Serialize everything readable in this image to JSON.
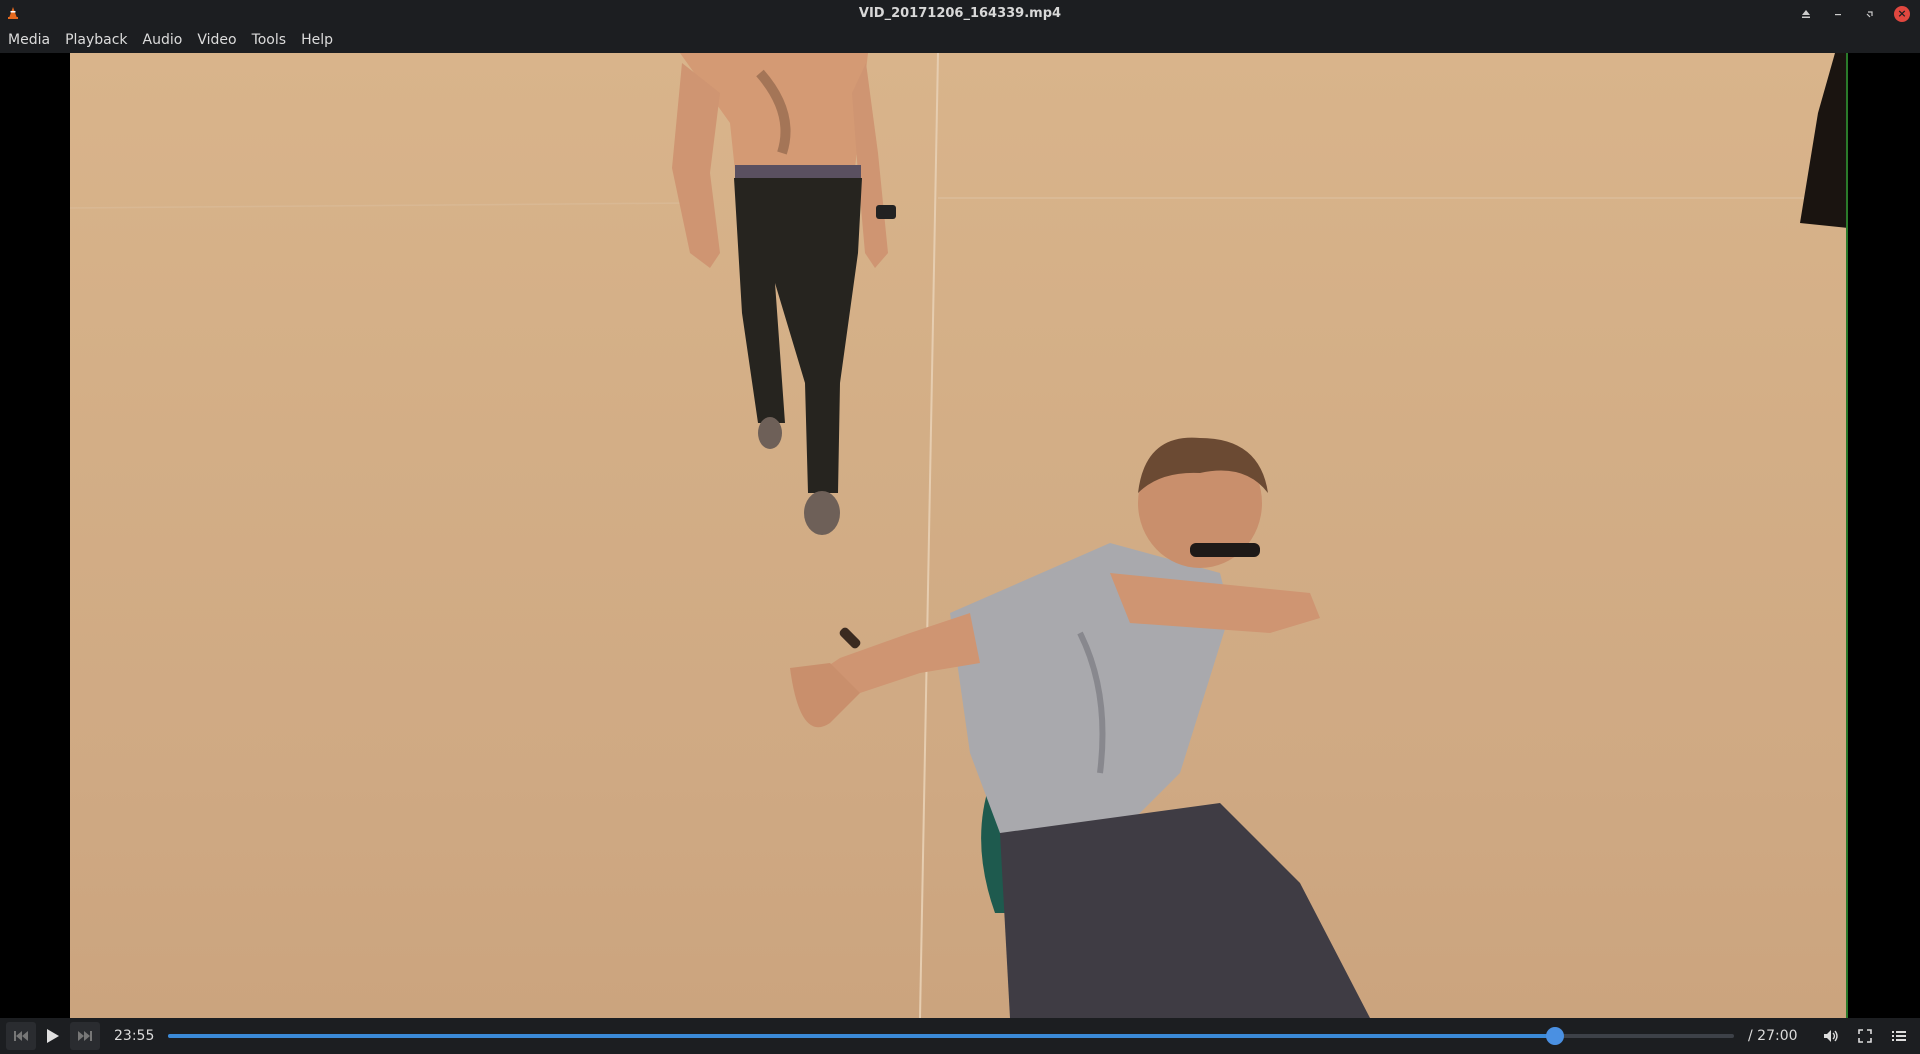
{
  "window": {
    "title": "VID_20171206_164339.mp4"
  },
  "menu": [
    "Media",
    "Playback",
    "Audio",
    "Video",
    "Tools",
    "Help"
  ],
  "player": {
    "current_time": "23:55",
    "total_time": "/ 27:00",
    "progress": 0.8858
  },
  "icons": {
    "app": "vlc-cone-icon",
    "eject": "eject-icon",
    "minimize": "minimize-icon",
    "restore": "restore-icon",
    "close": "close-icon",
    "prev": "skip-previous-icon",
    "play": "play-icon",
    "next": "skip-next-icon",
    "volume": "volume-icon",
    "fullscreen": "fullscreen-icon",
    "playlist": "playlist-icon"
  },
  "colors": {
    "accent": "#4a90e2",
    "chrome": "#1c1e21",
    "close": "#e0473f"
  }
}
